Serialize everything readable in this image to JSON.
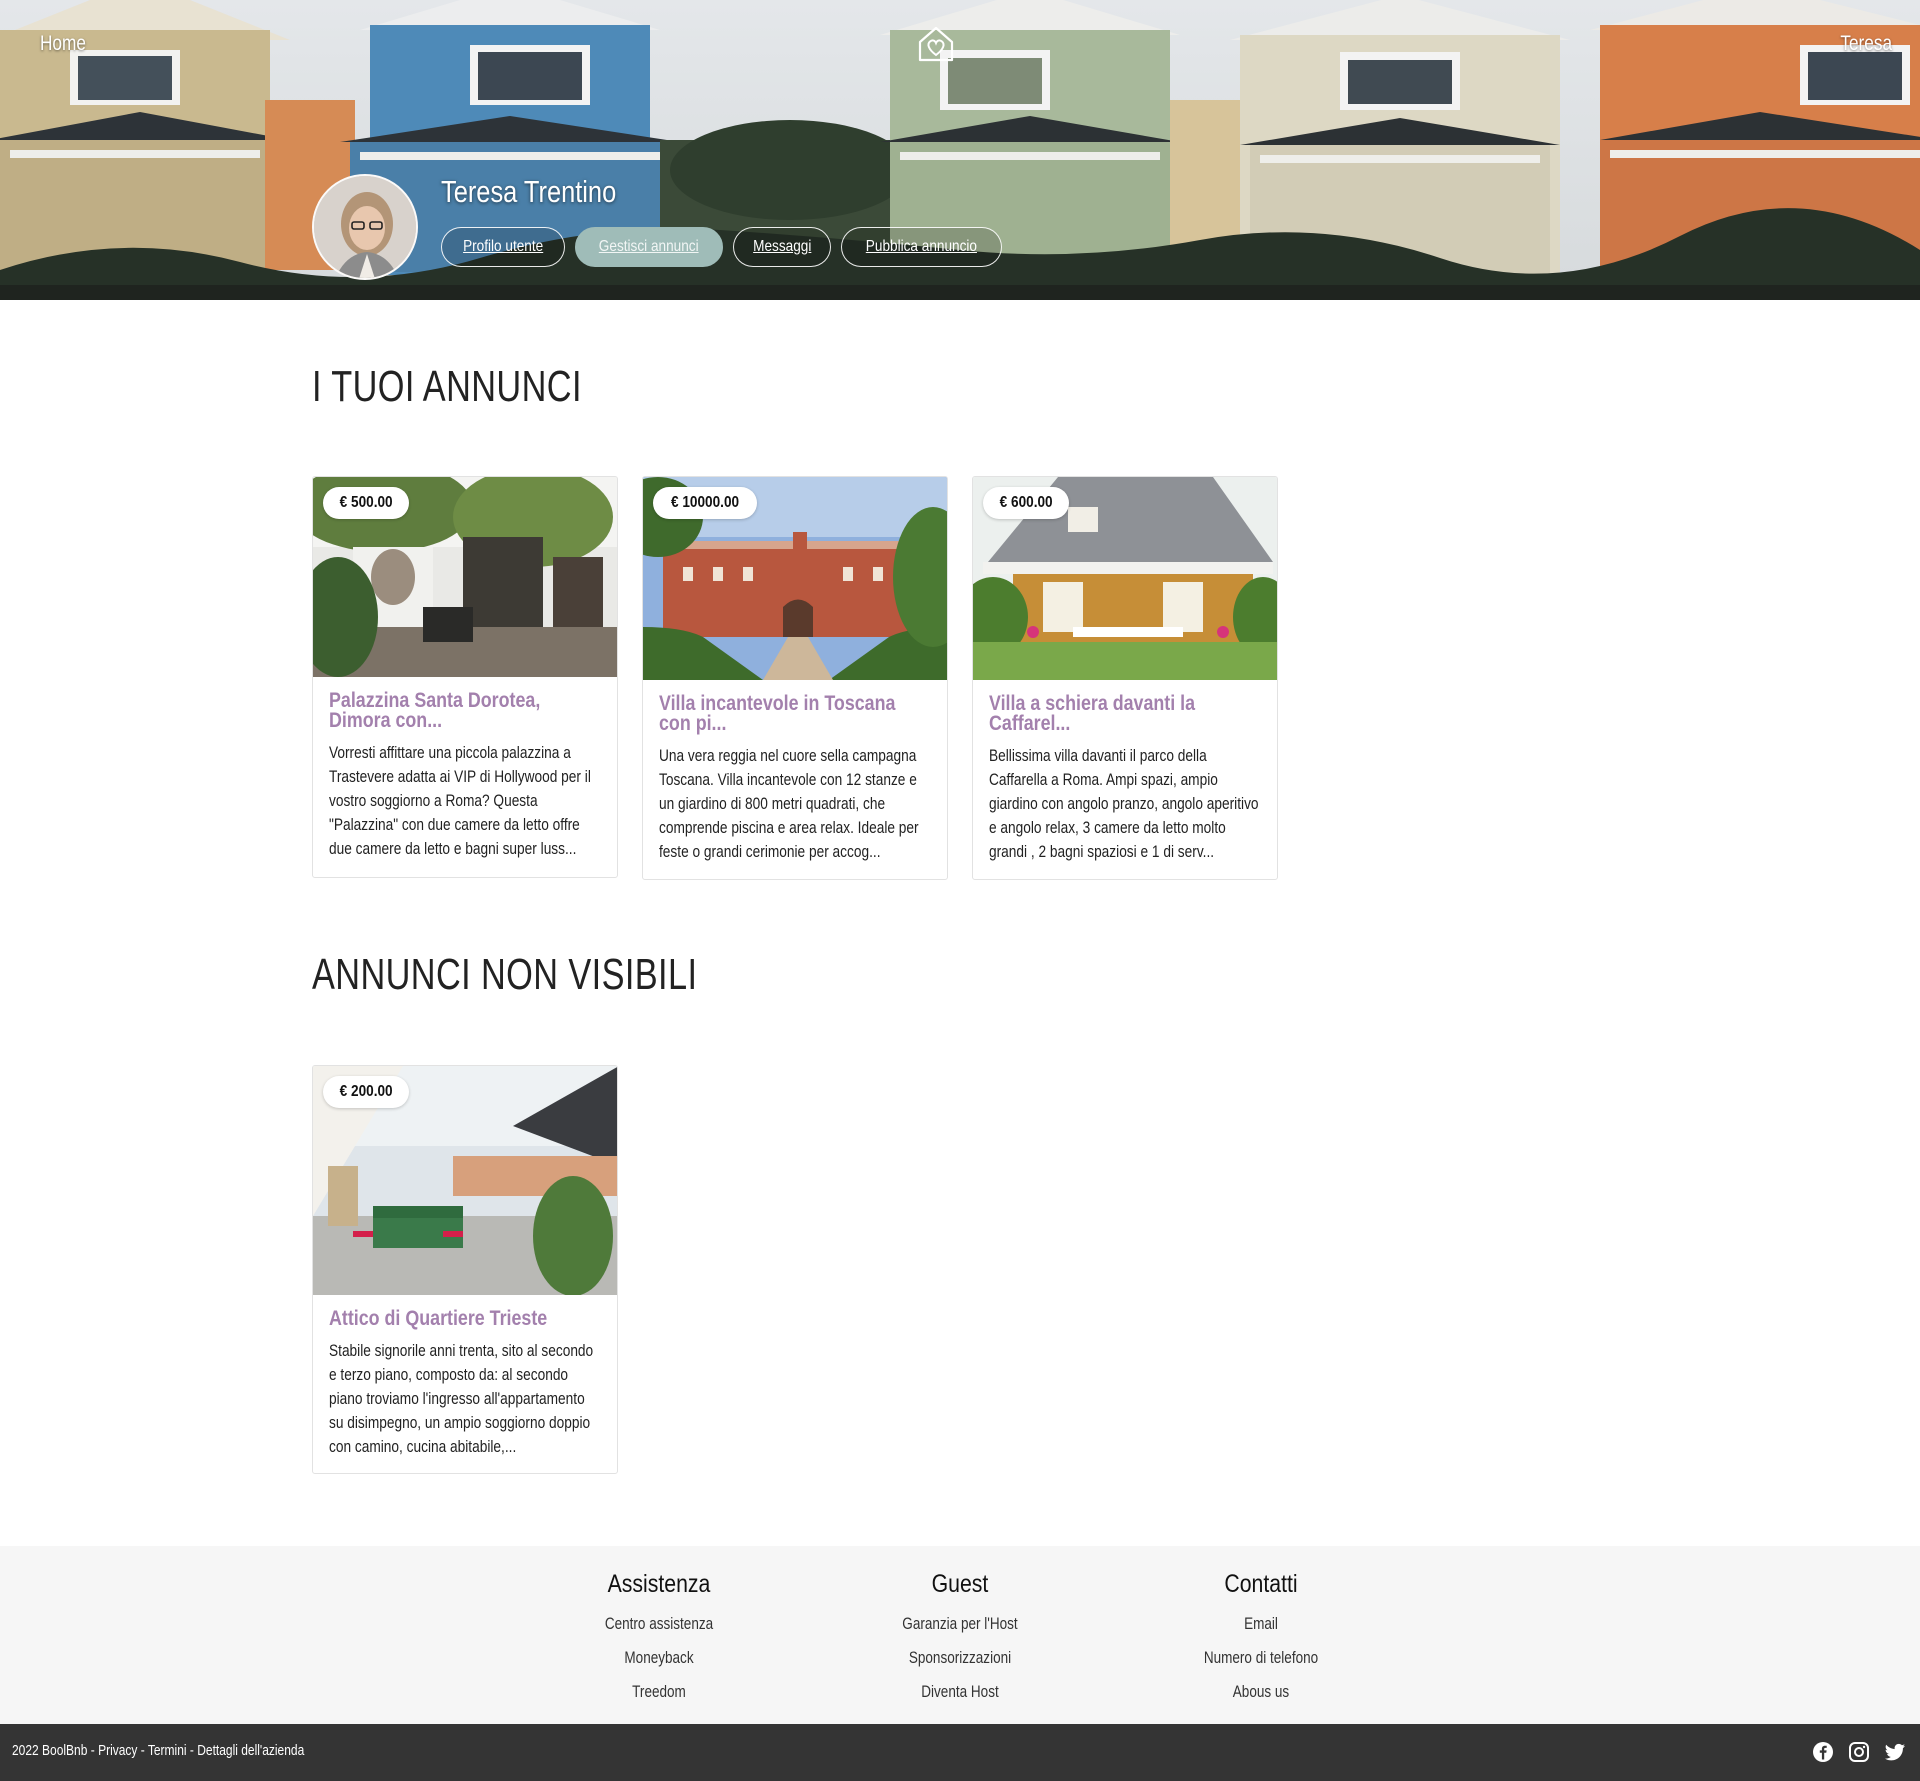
{
  "nav": {
    "home": "Home",
    "user": "Teresa"
  },
  "profile": {
    "name": "Teresa Trentino",
    "tabs": [
      "Profilo utente",
      "Gestisci annunci",
      "Messaggi",
      "Pubblica annuncio"
    ],
    "active_tab": "Gestisci annunci"
  },
  "sections": {
    "visible_title": "I TUOI ANNUNCI",
    "hidden_title": "ANNUNCI NON VISIBILI"
  },
  "listings": [
    {
      "price": "€ 500.00",
      "title": "Palazzina Santa Dorotea, Dimora con...",
      "description": "Vorresti affittare una piccola palazzina a Trastevere adatta ai VIP di Hollywood per il vostro soggiorno a Roma? Questa \"Palazzina\" con due camere da letto offre due camere da letto e bagni super luss..."
    },
    {
      "price": "€ 10000.00",
      "title": "Villa incantevole in Toscana con pi...",
      "description": "Una vera reggia nel cuore sella campagna Toscana. Villa incantevole con 12 stanze e un giardino di 800 metri quadrati, che comprende piscina e area relax. Ideale per feste o grandi cerimonie per accog..."
    },
    {
      "price": "€ 600.00",
      "title": "Villa a schiera davanti la Caffarel...",
      "description": "Bellissima villa davanti il parco della Caffarella a Roma. Ampi spazi, ampio giardino con angolo pranzo, angolo aperitivo e angolo relax, 3 camere da letto molto grandi , 2 bagni spaziosi e 1 di serv..."
    }
  ],
  "hidden_listings": [
    {
      "price": "€ 200.00",
      "title": "Attico di Quartiere Trieste",
      "description": "Stabile signorile anni trenta, sito al secondo e terzo piano, composto da: al secondo piano troviamo l'ingresso all'appartamento su disimpegno, un ampio soggiorno doppio con camino, cucina abitabile,..."
    }
  ],
  "footer": {
    "columns": [
      {
        "title": "Assistenza",
        "links": [
          "Centro assistenza",
          "Moneyback",
          "Treedom"
        ]
      },
      {
        "title": "Guest",
        "links": [
          "Garanzia per l'Host",
          "Sponsorizzazioni",
          "Diventa Host"
        ]
      },
      {
        "title": "Contatti",
        "links": [
          "Email",
          "Numero di telefono",
          "Abous us"
        ]
      }
    ],
    "copyright": "2022 BoolBnb",
    "legal_links": [
      "Privacy",
      "Termini",
      "Dettagli dell'azienda"
    ],
    "social_icons": [
      "facebook-icon",
      "instagram-icon",
      "twitter-icon"
    ]
  },
  "colors": {
    "accent_title": "#a380ad",
    "active_tab": "#9fbcb8",
    "footer_bar": "#343434",
    "footer_bg": "#f6f6f6"
  }
}
